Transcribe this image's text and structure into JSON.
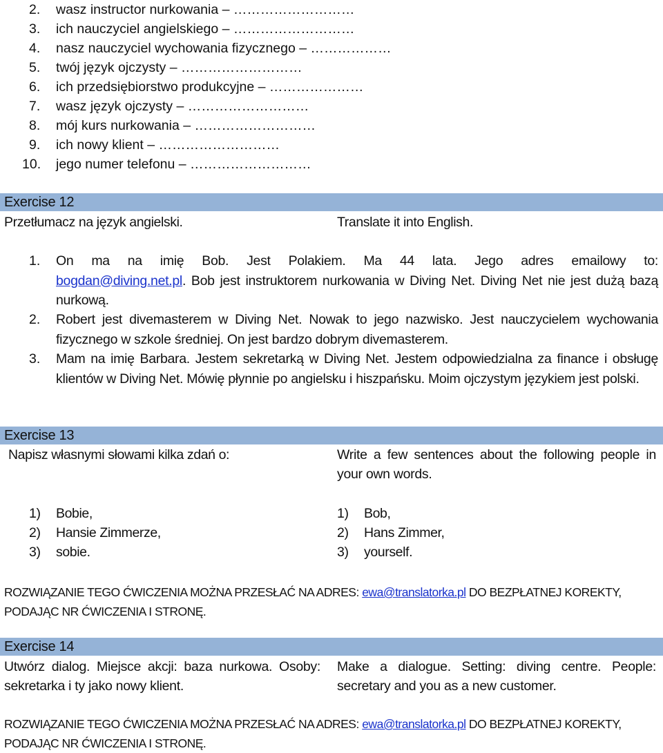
{
  "vocab_list": [
    {
      "num": "2.",
      "text": "wasz instructor nurkowania – ………………………"
    },
    {
      "num": "3.",
      "text": "ich nauczyciel angielskiego – ………………………"
    },
    {
      "num": "4.",
      "text": "nasz nauczyciel  wychowania fizycznego – ………………"
    },
    {
      "num": "5.",
      "text": "twój język ojczysty – ………………………"
    },
    {
      "num": "6.",
      "text": "ich przedsiębiorstwo produkcyjne – …………………"
    },
    {
      "num": "7.",
      "text": "wasz język ojczysty – ………………………"
    },
    {
      "num": "8.",
      "text": "mój kurs nurkowania – ………………………"
    },
    {
      "num": "9.",
      "text": "ich nowy klient – ………………………"
    },
    {
      "num": "10.",
      "text": "jego numer telefonu – ………………………"
    }
  ],
  "header_color": "#95b3d7",
  "link_color": "#1a33cc",
  "exercise12": {
    "title": "Exercise 12",
    "instruction_pl": "Przetłumacz na język angielski.",
    "instruction_en": "Translate it into English.",
    "items": [
      {
        "num": "1.",
        "before_link": "On ma na imię Bob. Jest Polakiem. Ma 44 lata. Jego adres emailowy to:",
        "link": "bogdan@diving.net.pl",
        "after_link": ". Bob jest instruktorem nurkowania w Diving Net. Diving Net nie jest dużą bazą nurkową."
      },
      {
        "num": "2.",
        "text": "Robert jest divemasterem w Diving Net. Nowak to jego nazwisko. Jest nauczycielem wychowania fizycznego w szkole średniej. On jest bardzo  dobrym divemasterem."
      },
      {
        "num": "3.",
        "text": "Mam na imię Barbara. Jestem sekretarką w Diving Net. Jestem odpowiedzialna za finance i obsługę klientów w Diving Net. Mówię płynnie po angielsku i hiszpańsku. Moim ojczystym językiem jest polski."
      }
    ]
  },
  "exercise13": {
    "title": "Exercise 13",
    "instruction_pl": "Napisz własnymi słowami kilka zdań o:",
    "instruction_en": "Write a few sentences about the following people in your own words.",
    "items_pl": [
      {
        "num": "1)",
        "text": "Bobie,"
      },
      {
        "num": "2)",
        "text": "Hansie Zimmerze,"
      },
      {
        "num": "3)",
        "text": "sobie."
      }
    ],
    "items_en": [
      {
        "num": "1)",
        "text": "Bob,"
      },
      {
        "num": "2)",
        "text": "Hans Zimmer,"
      },
      {
        "num": "3)",
        "text": "yourself."
      }
    ]
  },
  "notice": {
    "before_link": "ROZWIĄZANIE TEGO ĆWICZENIA MOŻNA PRZESŁAĆ NA ADRES: ",
    "link": "ewa@translatorka.pl",
    "after_link": " DO BEZPŁATNEJ KOREKTY, PODAJĄC NR ĆWICZENIA I STRONĘ."
  },
  "exercise14": {
    "title": "Exercise 14",
    "instruction_pl": "Utwórz dialog. Miejsce akcji: baza nurkowa. Osoby: sekretarka i ty jako nowy klient.",
    "instruction_en": "Make a dialogue. Setting: diving centre. People: secretary and you as a new customer."
  }
}
